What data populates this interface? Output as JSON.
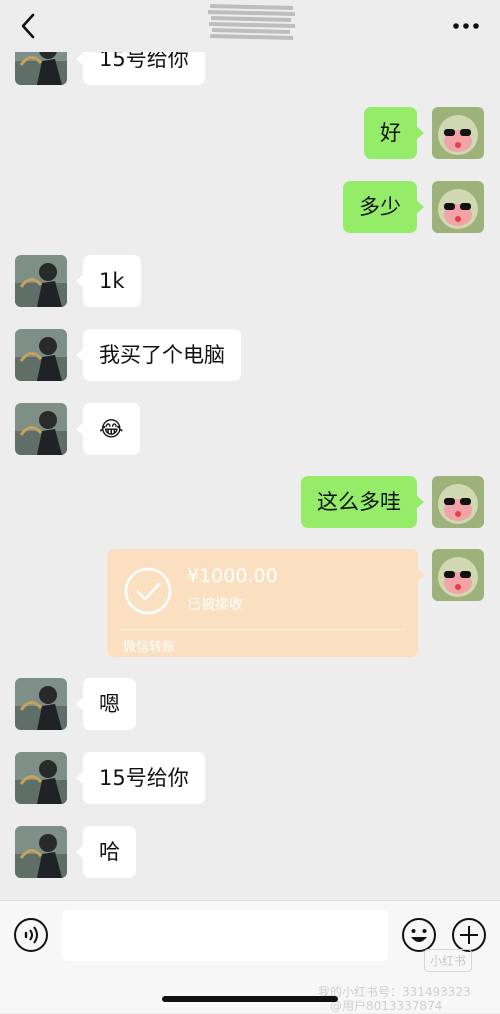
{
  "messages": [
    {
      "side": "in",
      "text": "15号给你"
    },
    {
      "side": "out",
      "text": "好"
    },
    {
      "side": "out",
      "text": "多少"
    },
    {
      "side": "in",
      "text": "1k"
    },
    {
      "side": "in",
      "text": "我买了个电脑"
    },
    {
      "side": "in",
      "text": "😂"
    },
    {
      "side": "out",
      "text": "这么多哇"
    },
    {
      "side": "in",
      "text": "嗯"
    },
    {
      "side": "in",
      "text": "15号给你"
    },
    {
      "side": "in",
      "text": "哈"
    }
  ],
  "transfer": {
    "amount": "¥1000.00",
    "status": "已被接收",
    "footer": "微信转账"
  },
  "input": {
    "placeholder": ""
  },
  "icons": {
    "back": "back-arrow-icon",
    "more": "more-dots-icon",
    "voice": "voice-icon",
    "emoji": "emoji-icon",
    "plus": "plus-icon",
    "transfer_check": "check-circle-icon"
  },
  "watermark": {
    "logo": "小红书",
    "line1": "我的小红书号：331493323",
    "line2": "@用户8013337874"
  },
  "colors": {
    "background": "#ededed",
    "outgoing_bubble": "#95ec69",
    "incoming_bubble": "#ffffff",
    "transfer_card": "#fae0c1"
  }
}
